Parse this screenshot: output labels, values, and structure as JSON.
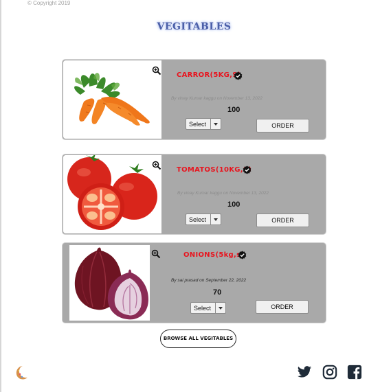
{
  "footer_top": {
    "copyright": "© Copyright 2019"
  },
  "page": {
    "title": "VEGITABLES"
  },
  "products": [
    {
      "name": "CARROR(5KG,S)",
      "byline": "By vinay Kumar kaggu on November 13, 2022",
      "price": "100",
      "select_label": "Select",
      "order_label": "ORDER"
    },
    {
      "name": "TOMATOS(10KG,S)",
      "byline": "By vinay Kumar kaggu on November 13, 2022",
      "price": "100",
      "select_label": "Select",
      "order_label": "ORDER"
    },
    {
      "name": "ONIONS(5kg,s)",
      "byline": "By sai prasad on September 22, 2022",
      "price": "70",
      "select_label": "Select",
      "order_label": "ORDER"
    }
  ],
  "browse": {
    "label": "BROWSE ALL VEGITABLES"
  },
  "icons": {
    "social": [
      "twitter-icon",
      "instagram-icon",
      "facebook-icon"
    ],
    "zoom": "zoom-in-icon",
    "verified": "verified-badge-icon"
  },
  "colors": {
    "card_bg": "#a9a9a9",
    "product_name": "#e8141e",
    "title": "#4b5fa8"
  }
}
